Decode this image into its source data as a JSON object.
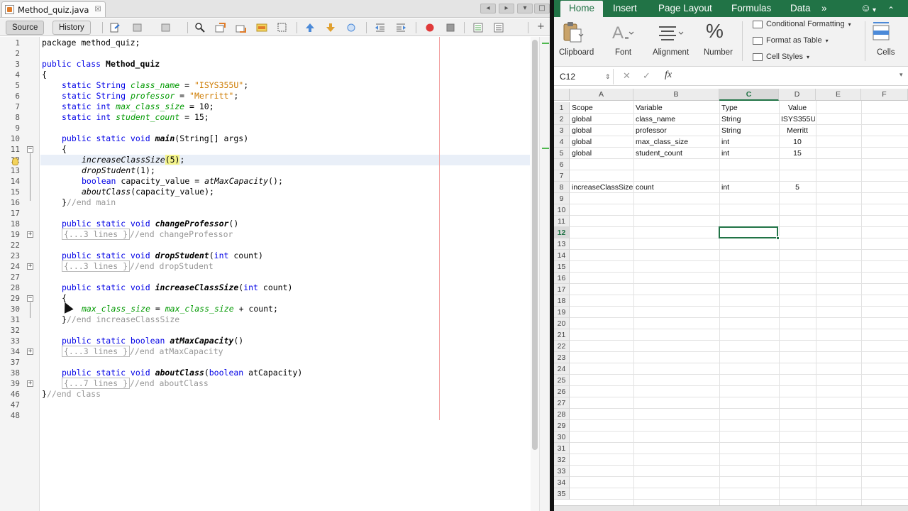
{
  "ide": {
    "file_tab": "Method_quiz.java",
    "views": {
      "source": "Source",
      "history": "History"
    },
    "toolbar_icons": [
      "last-edit-icon",
      "back-icon",
      "forward-icon",
      "find-icon",
      "find-previous-icon",
      "find-next-icon",
      "toggle-highlight-icon",
      "toggle-rectangle-icon",
      "previous-bookmark-icon",
      "next-bookmark-icon",
      "toggle-bookmark-icon",
      "shift-left-icon",
      "shift-right-icon",
      "start-macro-icon",
      "stop-macro-icon",
      "comment-icon",
      "uncomment-icon"
    ],
    "line_numbers": [
      "1",
      "2",
      "3",
      "4",
      "5",
      "6",
      "7",
      "8",
      "9",
      "10",
      "11",
      "12",
      "13",
      "14",
      "15",
      "16",
      "17",
      "18",
      "19",
      "22",
      "23",
      "24",
      "27",
      "28",
      "29",
      "30",
      "31",
      "32",
      "33",
      "34",
      "37",
      "38",
      "39",
      "46",
      "47",
      "48"
    ],
    "code": {
      "l1": "package method_quiz;",
      "l3_kw": "public class ",
      "l3_name": "Method_quiz",
      "l4": "{",
      "l5_type": "static String ",
      "l5_var": "class_name",
      "l5_eq": " = ",
      "l5_val": "\"ISYS355U\"",
      "l5_end": ";",
      "l6_type": "static String ",
      "l6_var": "professor",
      "l6_eq": " = ",
      "l6_val": "\"Merritt\"",
      "l6_end": ";",
      "l7_type": "static int ",
      "l7_var": "max_class_size",
      "l7_rest": " = 10;",
      "l8_type": "static int ",
      "l8_var": "student_count",
      "l8_rest": " = 15;",
      "l10_kw": "public static void ",
      "l10_name": "main",
      "l10_rest": "(String[] args)",
      "l11": "{",
      "l12_name": "increaseClassSize",
      "l12_arg": "(5)",
      "l12_end": ";",
      "l13_name": "dropStudent",
      "l13_rest": "(1);",
      "l14_kw": "boolean ",
      "l14_mid": "capacity_value = ",
      "l14_name": "atMaxCapacity",
      "l14_rest": "();",
      "l15_name": "aboutClass",
      "l15_rest": "(capacity_value);",
      "l16_brace": "}",
      "l16_cmt": "//end main",
      "l18_kw": "public static void ",
      "l18_name": "changeProfessor",
      "l18_rest": "()",
      "l19_fold": "{...3 lines }",
      "l19_cmt": "//end changeProfessor",
      "l23_kw": "public static void ",
      "l23_name": "dropStudent",
      "l23_p1": "(",
      "l23_p2": "int ",
      "l23_p3": "count)",
      "l24_fold": "{...3 lines }",
      "l24_cmt": "//end dropStudent",
      "l28_kw": "public static void ",
      "l28_name": "increaseClassSize",
      "l28_p1": "(",
      "l28_p2": "int ",
      "l28_p3": "count)",
      "l29": "{",
      "l30_v1": "max_class_size",
      "l30_eq": " = ",
      "l30_v2": "max_class_size",
      "l30_rest": " + count;",
      "l31_brace": "}",
      "l31_cmt": "//end increaseClassSize",
      "l33_kw": "public static boolean ",
      "l33_name": "atMaxCapacity",
      "l33_rest": "()",
      "l34_fold": "{...3 lines }",
      "l34_cmt": "//end atMaxCapacity",
      "l38_kw": "public static void ",
      "l38_name": "aboutClass",
      "l38_p1": "(",
      "l38_p2": "boolean ",
      "l38_p3": "atCapacity)",
      "l39_fold": "{...7 lines }",
      "l39_cmt": "//end aboutClass",
      "l46_brace": "}",
      "l46_cmt": "//end class"
    },
    "colors": {
      "keyword": "#0000e6",
      "string": "#ce7b00",
      "field": "#009900",
      "comment": "#969696"
    }
  },
  "excel": {
    "tabs": [
      "Home",
      "Insert",
      "Page Layout",
      "Formulas",
      "Data"
    ],
    "more_tabs": "»",
    "ribbon": {
      "clipboard": "Clipboard",
      "font": "Font",
      "alignment": "Alignment",
      "number": "Number",
      "number_glyph": "%",
      "conditional": "Conditional Formatting",
      "format_table": "Format as Table",
      "cell_styles": "Cell Styles",
      "cells": "Cells"
    },
    "name_box": "C12",
    "fx": "fx",
    "columns": [
      "A",
      "B",
      "C",
      "D",
      "E",
      "F"
    ],
    "selected_column": "C",
    "selected_row": "12",
    "rows": [
      "1",
      "2",
      "3",
      "4",
      "5",
      "6",
      "7",
      "8",
      "9",
      "10",
      "11",
      "12",
      "13",
      "14",
      "15",
      "16",
      "17",
      "18",
      "19",
      "20",
      "21",
      "22",
      "23",
      "24",
      "25",
      "26",
      "27",
      "28",
      "29",
      "30",
      "31",
      "32",
      "33",
      "34",
      "35"
    ],
    "cells": {
      "r1": [
        "Scope",
        "Variable",
        "Type",
        "Value"
      ],
      "r2": [
        "global",
        "class_name",
        "String",
        "ISYS355U"
      ],
      "r3": [
        "global",
        "professor",
        "String",
        "Merritt"
      ],
      "r4": [
        "global",
        "max_class_size",
        "int",
        "10"
      ],
      "r5": [
        "global",
        "student_count",
        "int",
        "15"
      ],
      "r8": [
        "increaseClassSize",
        "count",
        "int",
        "5"
      ]
    },
    "accent": "#217346"
  }
}
